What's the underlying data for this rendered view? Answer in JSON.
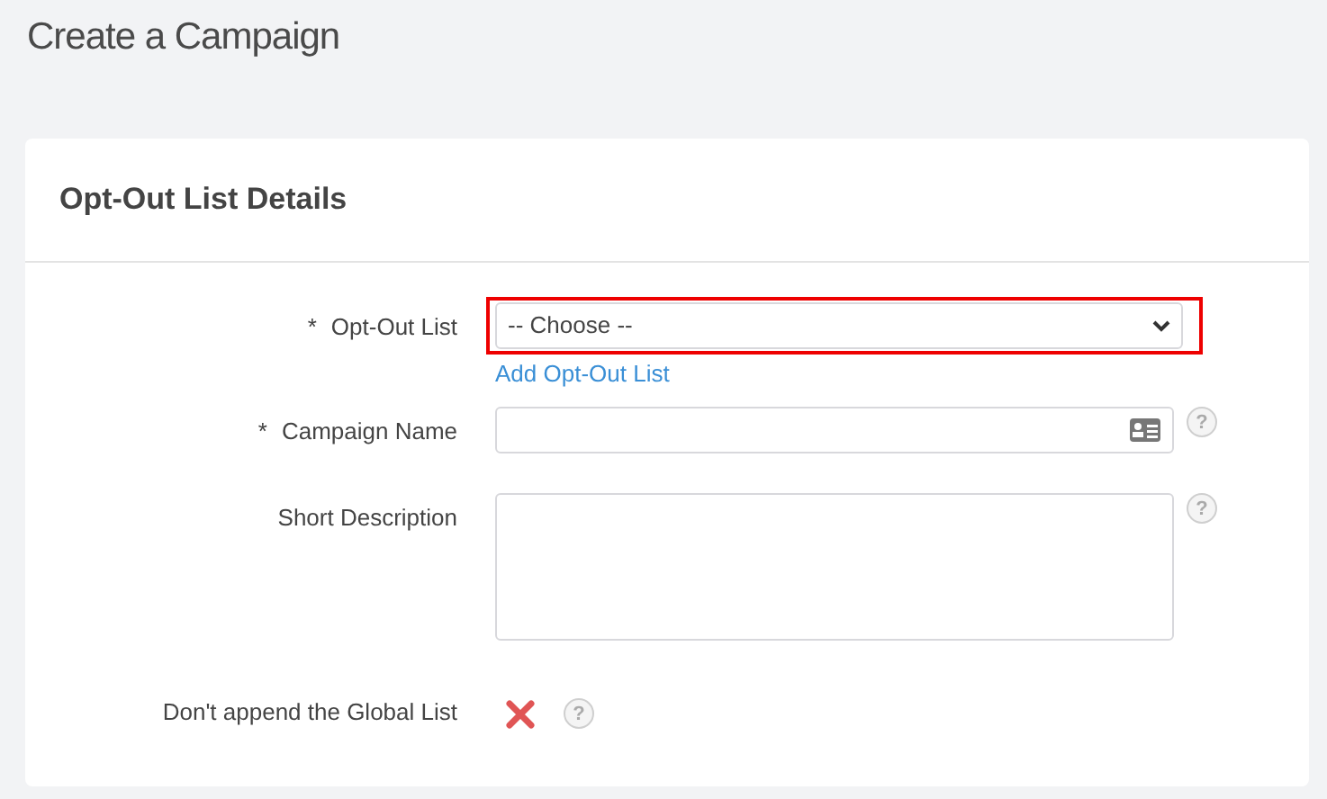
{
  "page_title": "Create a Campaign",
  "card": {
    "title": "Opt-Out List Details",
    "fields": [
      {
        "kind": "select",
        "label": "Opt-Out List",
        "required_mark": "*",
        "value": "-- Choose --",
        "highlighted": true,
        "link": "Add Opt-Out List"
      },
      {
        "kind": "text",
        "label": "Campaign Name",
        "required_mark": "*",
        "help": "?"
      },
      {
        "kind": "textarea",
        "label": "Short Description",
        "help": "?"
      },
      {
        "kind": "toggle",
        "label": "Don't append the Global List",
        "checked": false,
        "help": "?"
      }
    ]
  }
}
